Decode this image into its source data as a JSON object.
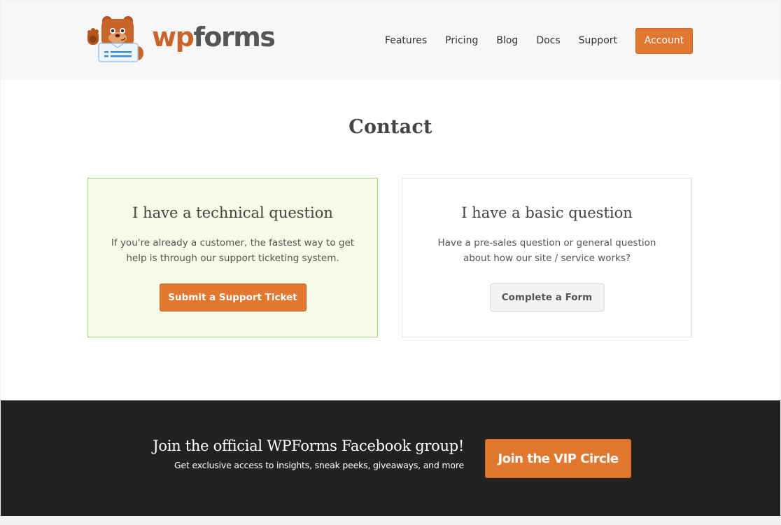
{
  "brand": {
    "name_part1": "wp",
    "name_part2": "forms",
    "accent_color": "#e27730"
  },
  "nav": {
    "items": [
      {
        "label": "Features"
      },
      {
        "label": "Pricing"
      },
      {
        "label": "Blog"
      },
      {
        "label": "Docs"
      },
      {
        "label": "Support"
      }
    ],
    "account_label": "Account"
  },
  "main": {
    "title": "Contact",
    "cards": [
      {
        "title": "I have a technical question",
        "text": "If you're already a customer, the fastest way to get help is through our support ticketing system.",
        "button_label": "Submit a Support Ticket"
      },
      {
        "title": "I have a basic question",
        "text": "Have a pre-sales question or general question about how our site / service works?",
        "button_label": "Complete a Form"
      }
    ]
  },
  "facebook_band": {
    "heading": "Join the official WPForms Facebook group!",
    "subtext": "Get exclusive access to insights, sneak peeks, giveaways, and more",
    "button_label": "Join the VIP Circle"
  }
}
